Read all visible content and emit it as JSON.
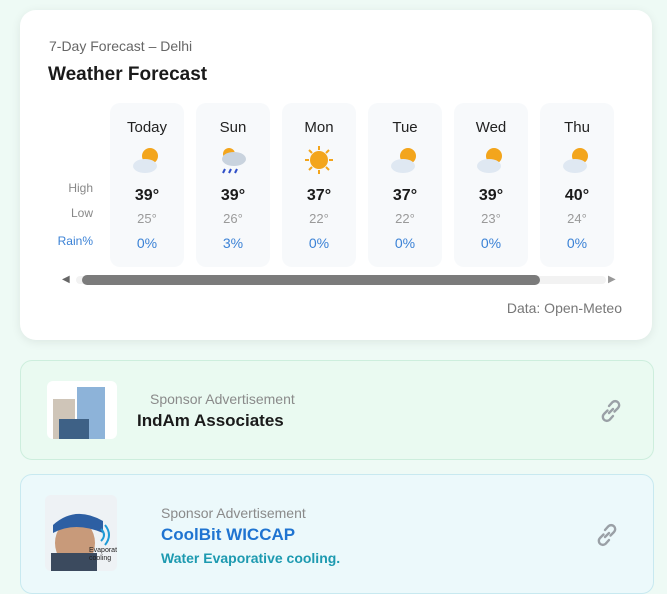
{
  "forecast": {
    "subtitle": "7-Day Forecast – Delhi",
    "title": "Weather Forecast",
    "row_labels": {
      "high": "High",
      "low": "Low",
      "rain": "Rain%"
    },
    "days": [
      {
        "name": "Today",
        "icon": "partly-cloudy-icon",
        "high": "39°",
        "low": "25°",
        "rain": "0%"
      },
      {
        "name": "Sun",
        "icon": "rain-cloud-icon",
        "high": "39°",
        "low": "26°",
        "rain": "3%"
      },
      {
        "name": "Mon",
        "icon": "sun-icon",
        "high": "37°",
        "low": "22°",
        "rain": "0%"
      },
      {
        "name": "Tue",
        "icon": "partly-cloudy-icon",
        "high": "37°",
        "low": "22°",
        "rain": "0%"
      },
      {
        "name": "Wed",
        "icon": "partly-cloudy-icon",
        "high": "39°",
        "low": "23°",
        "rain": "0%"
      },
      {
        "name": "Thu",
        "icon": "partly-cloudy-icon",
        "high": "40°",
        "low": "24°",
        "rain": "0%"
      }
    ],
    "source": "Data: Open-Meteo"
  },
  "ads": [
    {
      "tag": "Sponsor Advertisement",
      "name": "IndAm Associates",
      "name_color": "#1a1a1a",
      "logo": "building-logo-icon"
    },
    {
      "tag": "Sponsor Advertisement",
      "name": "CoolBit WICCAP",
      "name_color": "#1f74d1",
      "description": "Water Evaporative cooling.",
      "logo": "person-cap-image",
      "logo_text": "Evaporat cooling"
    }
  ],
  "colors": {
    "accent_blue": "#3b82d6",
    "teal": "#1d9ab0",
    "sun": "#f3a51c"
  }
}
